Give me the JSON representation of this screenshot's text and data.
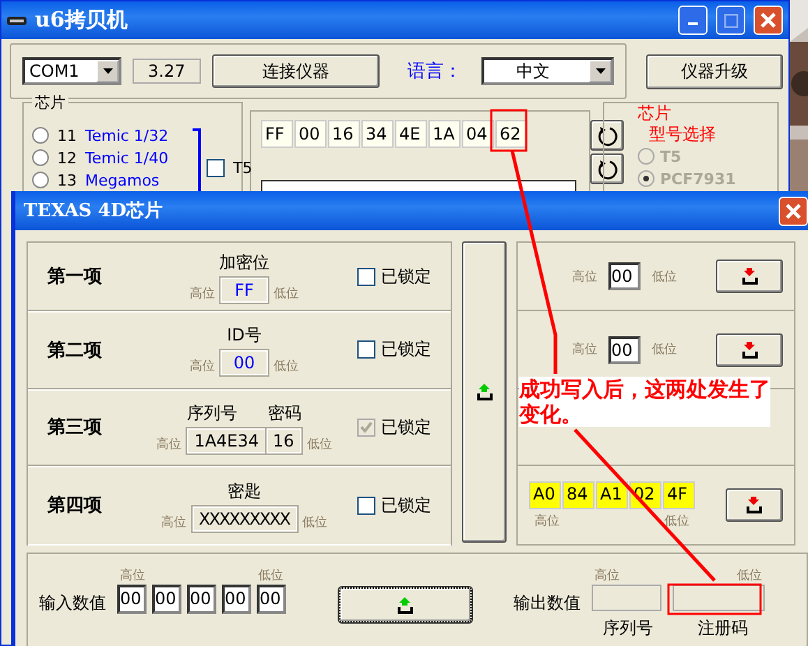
{
  "window": {
    "title": "u6拷贝机"
  },
  "toolbar": {
    "port": "COM1",
    "version": "3.27",
    "connect_button": "连接仪器",
    "language_label": "语言：",
    "language": "中文",
    "upgrade_button": "仪器升级"
  },
  "chip_group": {
    "title": "芯片",
    "options": [
      {
        "number": "11",
        "name": "Temic 1/32",
        "selected": false
      },
      {
        "number": "12",
        "name": "Temic 1/40",
        "selected": false
      },
      {
        "number": "13",
        "name": "Megamos",
        "selected": false
      }
    ],
    "t5": {
      "label": "T5",
      "checked": false
    }
  },
  "hex_bytes": [
    "FF",
    "00",
    "16",
    "34",
    "4E",
    "1A",
    "04",
    "62"
  ],
  "model_group": {
    "title": "芯片",
    "subtitle": "型号选择",
    "disabled": true,
    "options": [
      {
        "label": "T5",
        "selected": false
      },
      {
        "label": "PCF7931",
        "selected": true
      }
    ]
  },
  "dialog": {
    "title": "TEXAS 4D芯片",
    "items": [
      {
        "label": "第一项",
        "kind": "single",
        "captions": [
          "加密位"
        ],
        "values": [
          "FF"
        ],
        "high": "高位",
        "low": "低位",
        "lock_label": "已锁定",
        "locked": false,
        "lock_disabled": false
      },
      {
        "label": "第二项",
        "kind": "single",
        "captions": [
          "ID号"
        ],
        "values": [
          "00"
        ],
        "high": "高位",
        "low": "低位",
        "lock_label": "已锁定",
        "locked": false,
        "lock_disabled": false
      },
      {
        "label": "第三项",
        "kind": "pair",
        "captions": [
          "序列号",
          "密码"
        ],
        "values": [
          "1A4E34",
          "16"
        ],
        "high": "高位",
        "low": "低位",
        "lock_label": "已锁定",
        "locked": true,
        "lock_disabled": true
      },
      {
        "label": "第四项",
        "kind": "masked",
        "captions": [
          "密匙"
        ],
        "values": [
          "XXXXXXXXX"
        ],
        "high": "高位",
        "low": "低位",
        "lock_label": "已锁定",
        "locked": false,
        "lock_disabled": false
      }
    ],
    "read_rows": [
      {
        "kind": "single",
        "high": "高位",
        "values": [
          "00"
        ],
        "low": "低位"
      },
      {
        "kind": "single",
        "high": "高位",
        "values": [
          "00"
        ],
        "low": "低位"
      },
      {
        "kind": "empty"
      },
      {
        "kind": "bytes",
        "high": "高位",
        "values": [
          "A0",
          "84",
          "A1",
          "02",
          "4F"
        ],
        "low": "低位"
      }
    ],
    "input": {
      "label": "输入数值",
      "high": "高位",
      "low": "低位",
      "values": [
        "00",
        "00",
        "00",
        "00",
        "00"
      ]
    },
    "output": {
      "label": "输出数值",
      "high": "高位",
      "low": "低位",
      "captions": [
        "序列号",
        "注册码"
      ]
    }
  },
  "annotation": {
    "text": "成功写入后，这两处发生了变化。"
  }
}
